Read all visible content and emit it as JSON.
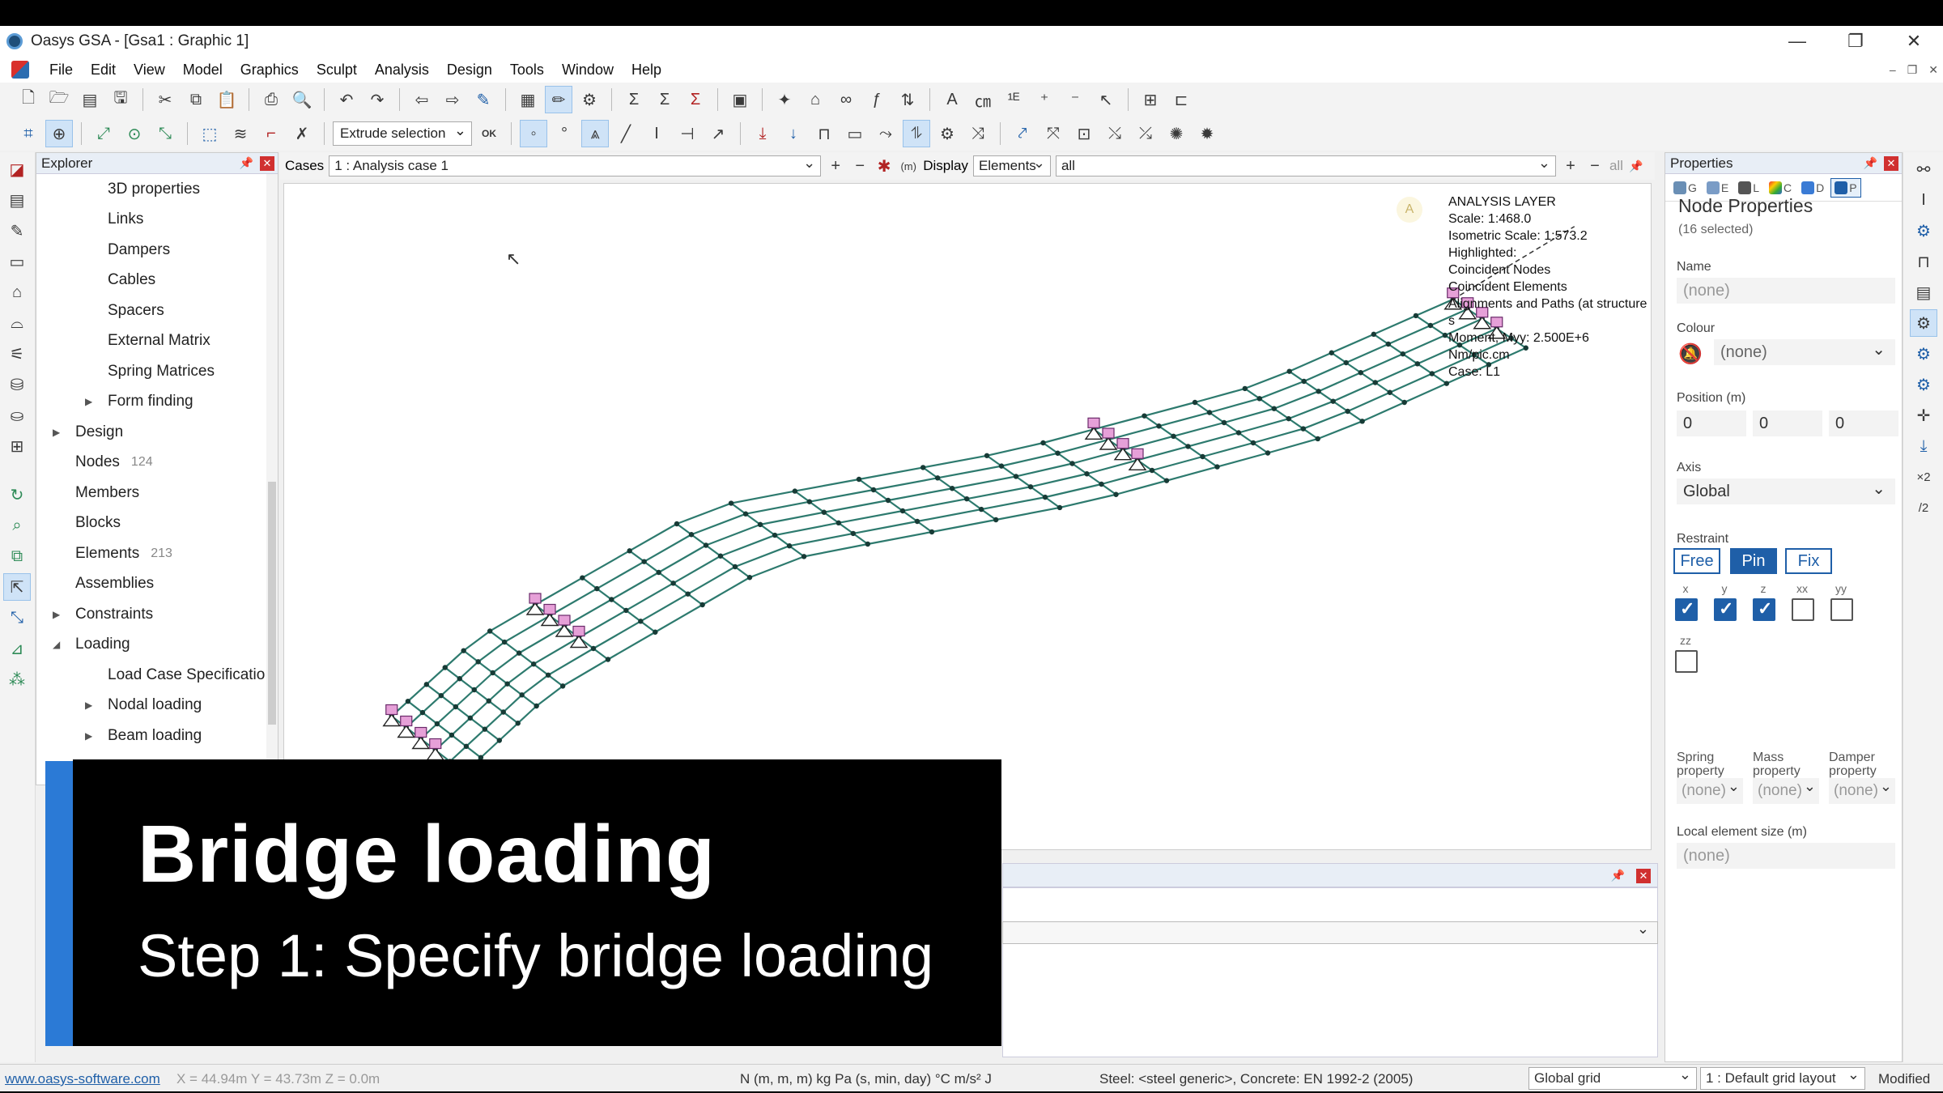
{
  "window": {
    "title": "Oasys GSA - [Gsa1 : Graphic 1]",
    "minimize": "—",
    "restore": "❐",
    "close": "✕"
  },
  "menu": [
    "File",
    "Edit",
    "View",
    "Model",
    "Graphics",
    "Sculpt",
    "Analysis",
    "Design",
    "Tools",
    "Window",
    "Help"
  ],
  "toolbar": {
    "extrude_label": "Extrude selection",
    "ok_label": "OK"
  },
  "explorer": {
    "title": "Explorer",
    "items": [
      {
        "label": "3D properties",
        "indent": 2
      },
      {
        "label": "Links",
        "indent": 2
      },
      {
        "label": "Dampers",
        "indent": 2
      },
      {
        "label": "Cables",
        "indent": 2
      },
      {
        "label": "Spacers",
        "indent": 2
      },
      {
        "label": "External Matrix",
        "indent": 2
      },
      {
        "label": "Spring Matrices",
        "indent": 2
      },
      {
        "label": "Form finding",
        "indent": 2,
        "expander": "▶"
      },
      {
        "label": "Design",
        "indent": 1,
        "expander": "▶"
      },
      {
        "label": "Nodes",
        "indent": 1,
        "count": "124"
      },
      {
        "label": "Members",
        "indent": 1
      },
      {
        "label": "Blocks",
        "indent": 1
      },
      {
        "label": "Elements",
        "indent": 1,
        "count": "213"
      },
      {
        "label": "Assemblies",
        "indent": 1
      },
      {
        "label": "Constraints",
        "indent": 1,
        "expander": "▶"
      },
      {
        "label": "Loading",
        "indent": 1,
        "expander": "◢"
      },
      {
        "label": "Load Case Specificatio",
        "indent": 2
      },
      {
        "label": "Nodal loading",
        "indent": 2,
        "expander": "▶"
      },
      {
        "label": "Beam loading",
        "indent": 2,
        "expander": "▶"
      }
    ]
  },
  "cases_bar": {
    "cases_label": "Cases",
    "case_value": "1 : Analysis case 1",
    "display_label": "Display",
    "display_value": "Elements",
    "filter_value": "all",
    "all_label": "all"
  },
  "graphic": {
    "info_lines": [
      "ANALYSIS LAYER",
      "Scale: 1:468.0",
      "Isometric Scale: 1:573.2",
      "Highlighted:",
      "Coincident Nodes",
      "Coincident Elements",
      "Alignments and Paths (at structure s",
      "Moment, Myy: 2.500E+6 Nm/pic.cm",
      "Case: L1"
    ],
    "badge": "A",
    "label_inside": "side"
  },
  "properties": {
    "panel_title": "Properties",
    "tabs": [
      "G",
      "E",
      "L",
      "C",
      "D",
      "P"
    ],
    "title": "Node Properties",
    "subtitle": "(16 selected)",
    "name_label": "Name",
    "name_value": "(none)",
    "colour_label": "Colour",
    "colour_value": "(none)",
    "position_label": "Position (m)",
    "pos": [
      "0",
      "0",
      "0"
    ],
    "axis_label": "Axis",
    "axis_value": "Global",
    "restraint_label": "Restraint",
    "restraint_buttons": [
      "Free",
      "Pin",
      "Fix"
    ],
    "dofs": [
      "x",
      "y",
      "z",
      "xx",
      "yy",
      "zz"
    ],
    "spring_label": "Spring property",
    "mass_label": "Mass property",
    "damper_label": "Damper property",
    "spring_value": "(none)",
    "mass_value": "(none)",
    "damper_value": "(none)",
    "local_size_label": "Local element size (m)",
    "local_size_value": "(none)"
  },
  "status": {
    "link": "www.oasys-software.com",
    "coords": "X = 44.94m    Y = 43.73m    Z = 0.0m",
    "units": "N  (m, m, m)  kg  Pa  (s, min, day)  °C  m/s²  J",
    "materials": "Steel: <steel generic>, Concrete: EN 1992-2 (2005)",
    "grid": "Global grid",
    "layout": "1 : Default grid layout",
    "modified": "Modified"
  },
  "banner": {
    "title": "Bridge loading",
    "subtitle": "Step 1: Specify bridge loading"
  },
  "colors": {
    "mesh": "#2d7a6e",
    "support": "#e6a0d8",
    "accent": "#1f5fa8",
    "banner_accent": "#2b7ad6"
  }
}
